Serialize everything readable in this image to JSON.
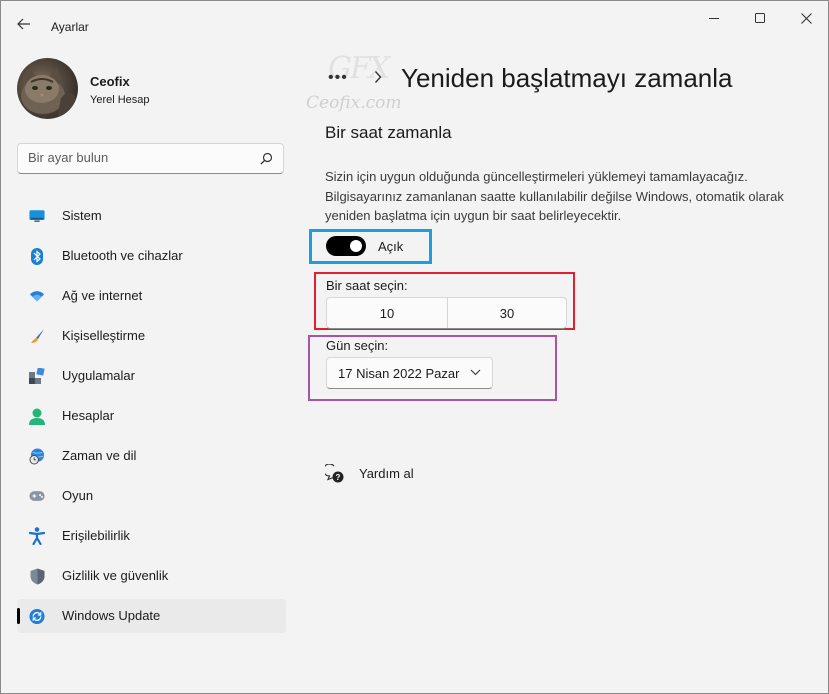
{
  "window": {
    "title": "Ayarlar"
  },
  "profile": {
    "name": "Ceofix",
    "account_type": "Yerel Hesap"
  },
  "search": {
    "placeholder": "Bir ayar bulun"
  },
  "sidebar": {
    "items": [
      {
        "label": "Sistem",
        "icon": "monitor-icon"
      },
      {
        "label": "Bluetooth ve cihazlar",
        "icon": "bluetooth-icon"
      },
      {
        "label": "Ağ ve internet",
        "icon": "wifi-icon"
      },
      {
        "label": "Kişiselleştirme",
        "icon": "brush-icon"
      },
      {
        "label": "Uygulamalar",
        "icon": "apps-icon"
      },
      {
        "label": "Hesaplar",
        "icon": "person-icon"
      },
      {
        "label": "Zaman ve dil",
        "icon": "globe-clock-icon"
      },
      {
        "label": "Oyun",
        "icon": "gamepad-icon"
      },
      {
        "label": "Erişilebilirlik",
        "icon": "accessibility-icon"
      },
      {
        "label": "Gizlilik ve güvenlik",
        "icon": "shield-icon"
      },
      {
        "label": "Windows Update",
        "icon": "update-icon",
        "active": true
      }
    ]
  },
  "header": {
    "more": "•••",
    "title": "Yeniden başlatmayı zamanla"
  },
  "watermark": {
    "logo": "GFX",
    "text": "Ceofix.com"
  },
  "schedule": {
    "section_title": "Bir saat zamanla",
    "description": "Sizin için uygun olduğunda güncelleştirmeleri yüklemeyi tamamlayacağız. Bilgisayarınız zamanlanan saatte kullanılabilir değilse Windows, otomatik olarak yeniden başlatma için uygun bir saat belirleyecektir.",
    "toggle": {
      "state": "on",
      "label": "Açık"
    },
    "time_label": "Bir saat seçin:",
    "hour": "10",
    "minute": "30",
    "day_label": "Gün seçin:",
    "day_value": "17 Nisan 2022 Pazar"
  },
  "help": {
    "label": "Yardım al"
  },
  "colors": {
    "highlight_blue": "#1aa0e0",
    "highlight_red": "#e0202c",
    "highlight_purple": "#a455a8",
    "toggle_on": "#000000"
  }
}
